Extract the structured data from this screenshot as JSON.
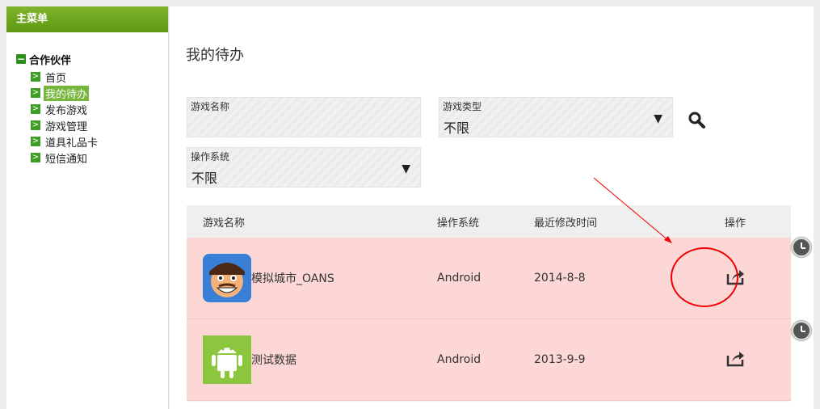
{
  "sidebar": {
    "header": "主菜单",
    "group": "合作伙伴",
    "items": [
      {
        "label": "首页",
        "active": false
      },
      {
        "label": "我的待办",
        "active": true
      },
      {
        "label": "发布游戏",
        "active": false
      },
      {
        "label": "游戏管理",
        "active": false
      },
      {
        "label": "道具礼品卡",
        "active": false
      },
      {
        "label": "短信通知",
        "active": false
      }
    ]
  },
  "main": {
    "title": "我的待办",
    "filters": {
      "game_name": {
        "label": "游戏名称",
        "value": ""
      },
      "game_type": {
        "label": "游戏类型",
        "value": "不限"
      },
      "os": {
        "label": "操作系统",
        "value": "不限"
      }
    },
    "table": {
      "headers": [
        "游戏名称",
        "操作系统",
        "最近修改时间",
        "操作"
      ],
      "rows": [
        {
          "name": "模拟城市_OANS",
          "os": "Android",
          "time": "2014-8-8",
          "icon": "character-face-icon"
        },
        {
          "name": "测试数据",
          "os": "Android",
          "time": "2013-9-9",
          "icon": "android-robot-icon"
        }
      ]
    }
  },
  "colors": {
    "accent": "#6aa51f",
    "row_bg": "#fdd6d6",
    "annotation": "#e00000"
  }
}
